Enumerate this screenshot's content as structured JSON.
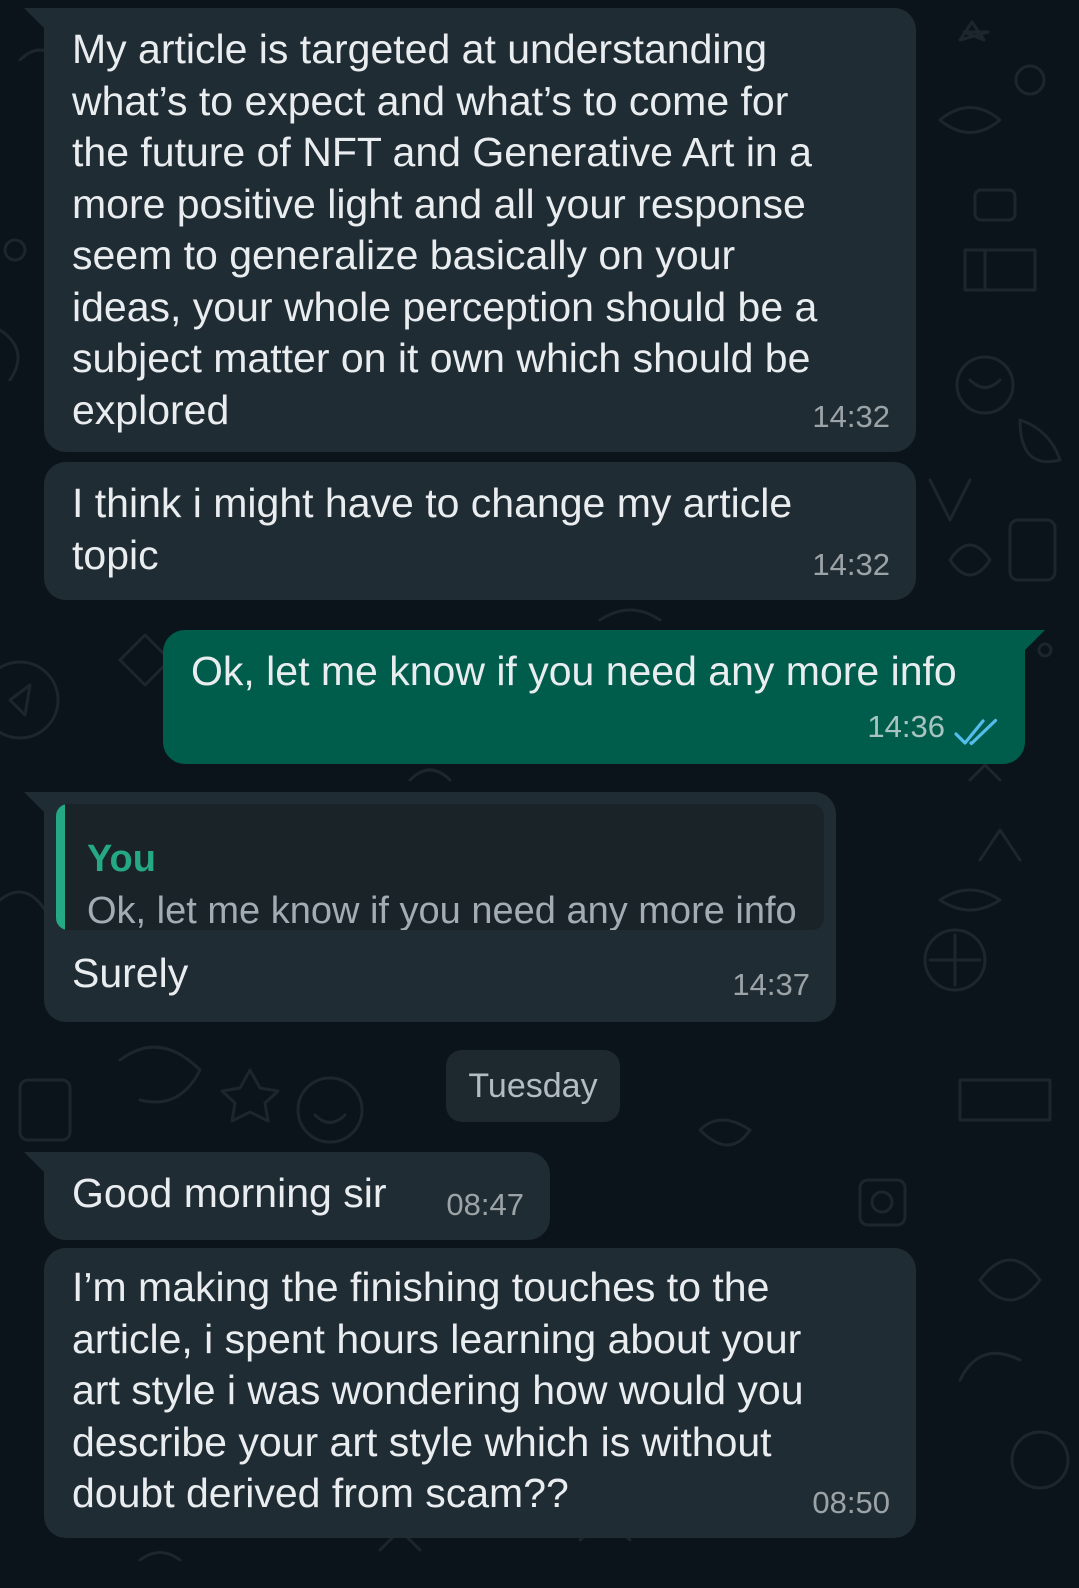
{
  "chat": {
    "colors": {
      "background": "#0b141a",
      "incoming_bubble": "#202c33",
      "outgoing_bubble": "#005c4b",
      "text": "#e9edef",
      "read_ticks": "#53bdeb",
      "quote_accent": "#25a884"
    },
    "messages": [
      {
        "direction": "incoming",
        "text": "My article is targeted at understanding\nwhat’s to expect and what’s to come for\nthe future of NFT and Generative Art in a\nmore positive light and all your response\nseem to generalize basically on your\nideas, your whole perception should be a\nsubject matter on it own which should be\nexplored",
        "time": "14:32"
      },
      {
        "direction": "incoming",
        "text": "I think i might have to change my article\ntopic",
        "time": "14:32"
      },
      {
        "direction": "outgoing",
        "text": "Ok, let me know if you need any more info",
        "time": "14:36",
        "status_icon": "double-check-read-icon"
      },
      {
        "direction": "incoming",
        "quote": {
          "author": "You",
          "text": "Ok, let me know if you need any more info"
        },
        "text": "Surely",
        "time": "14:37"
      },
      {
        "direction": "incoming",
        "text": "Good morning sir",
        "time": "08:47"
      },
      {
        "direction": "incoming",
        "text": "I’m making the finishing touches to the\narticle, i spent hours learning about your\nart style i was wondering how would you\ndescribe your art style which is without\ndoubt derived from scam??",
        "time": "08:50"
      }
    ],
    "day_divider": "Tuesday"
  }
}
